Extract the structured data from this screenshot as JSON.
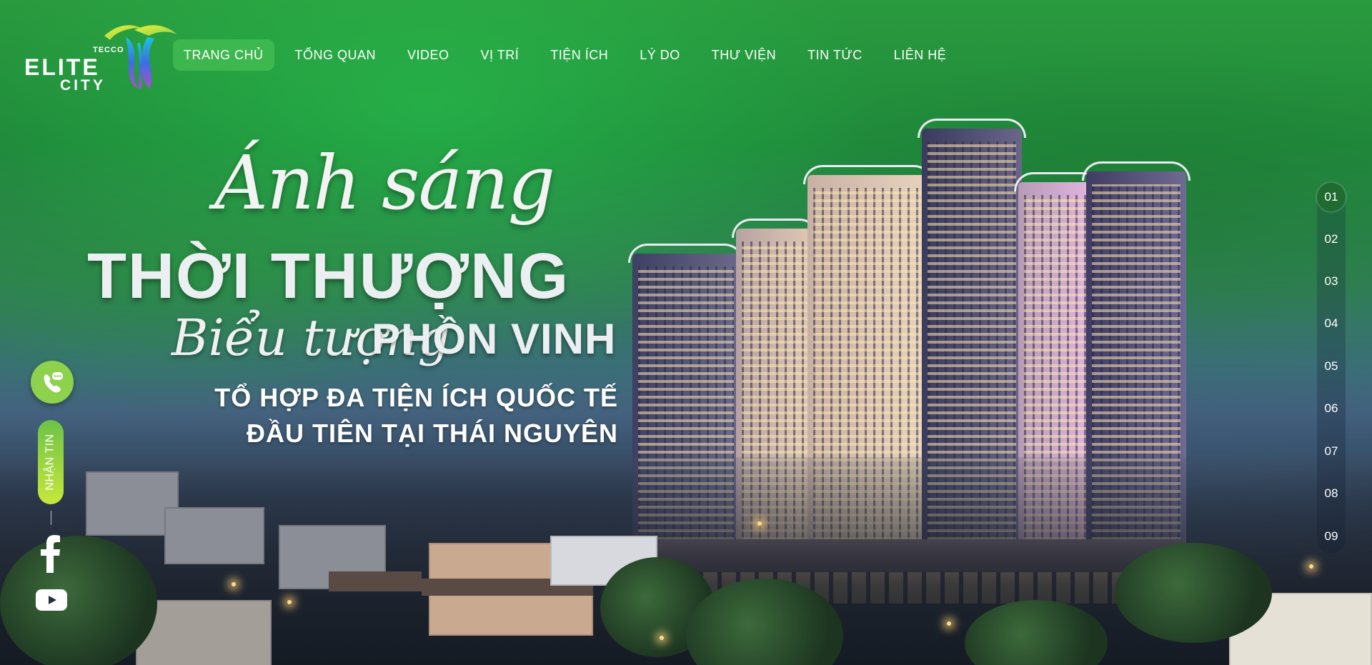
{
  "brand": {
    "tecco": "TECCO",
    "elite": "ELITE",
    "city": "CITY"
  },
  "nav": {
    "items": [
      "TRANG CHỦ",
      "TỔNG QUAN",
      "VIDEO",
      "VỊ TRÍ",
      "TIỆN ÍCH",
      "LÝ DO",
      "THƯ VIỆN",
      "TIN TỨC",
      "LIÊN HỆ"
    ],
    "active_index": 0
  },
  "headline": {
    "script1": "Ánh sáng",
    "big1": "THỜI THƯỢNG",
    "script2": "Biểu tượng",
    "big2": "PHỒN VINH",
    "sub1": "TỔ HỢP ĐA TIỆN ÍCH QUỐC TẾ",
    "sub2": "ĐẦU TIÊN TẠI THÁI NGUYÊN"
  },
  "sidebar_left": {
    "newsletter_label": "NHẬN TIN",
    "icons": [
      "phone-chat-icon",
      "facebook-icon",
      "youtube-icon"
    ]
  },
  "pager": {
    "pages": [
      "01",
      "02",
      "03",
      "04",
      "05",
      "06",
      "07",
      "08",
      "09"
    ],
    "active_index": 0
  },
  "colors": {
    "accent": "#8ed14c",
    "active_nav": "#50c85a",
    "pager_active": "#1f6b30"
  }
}
